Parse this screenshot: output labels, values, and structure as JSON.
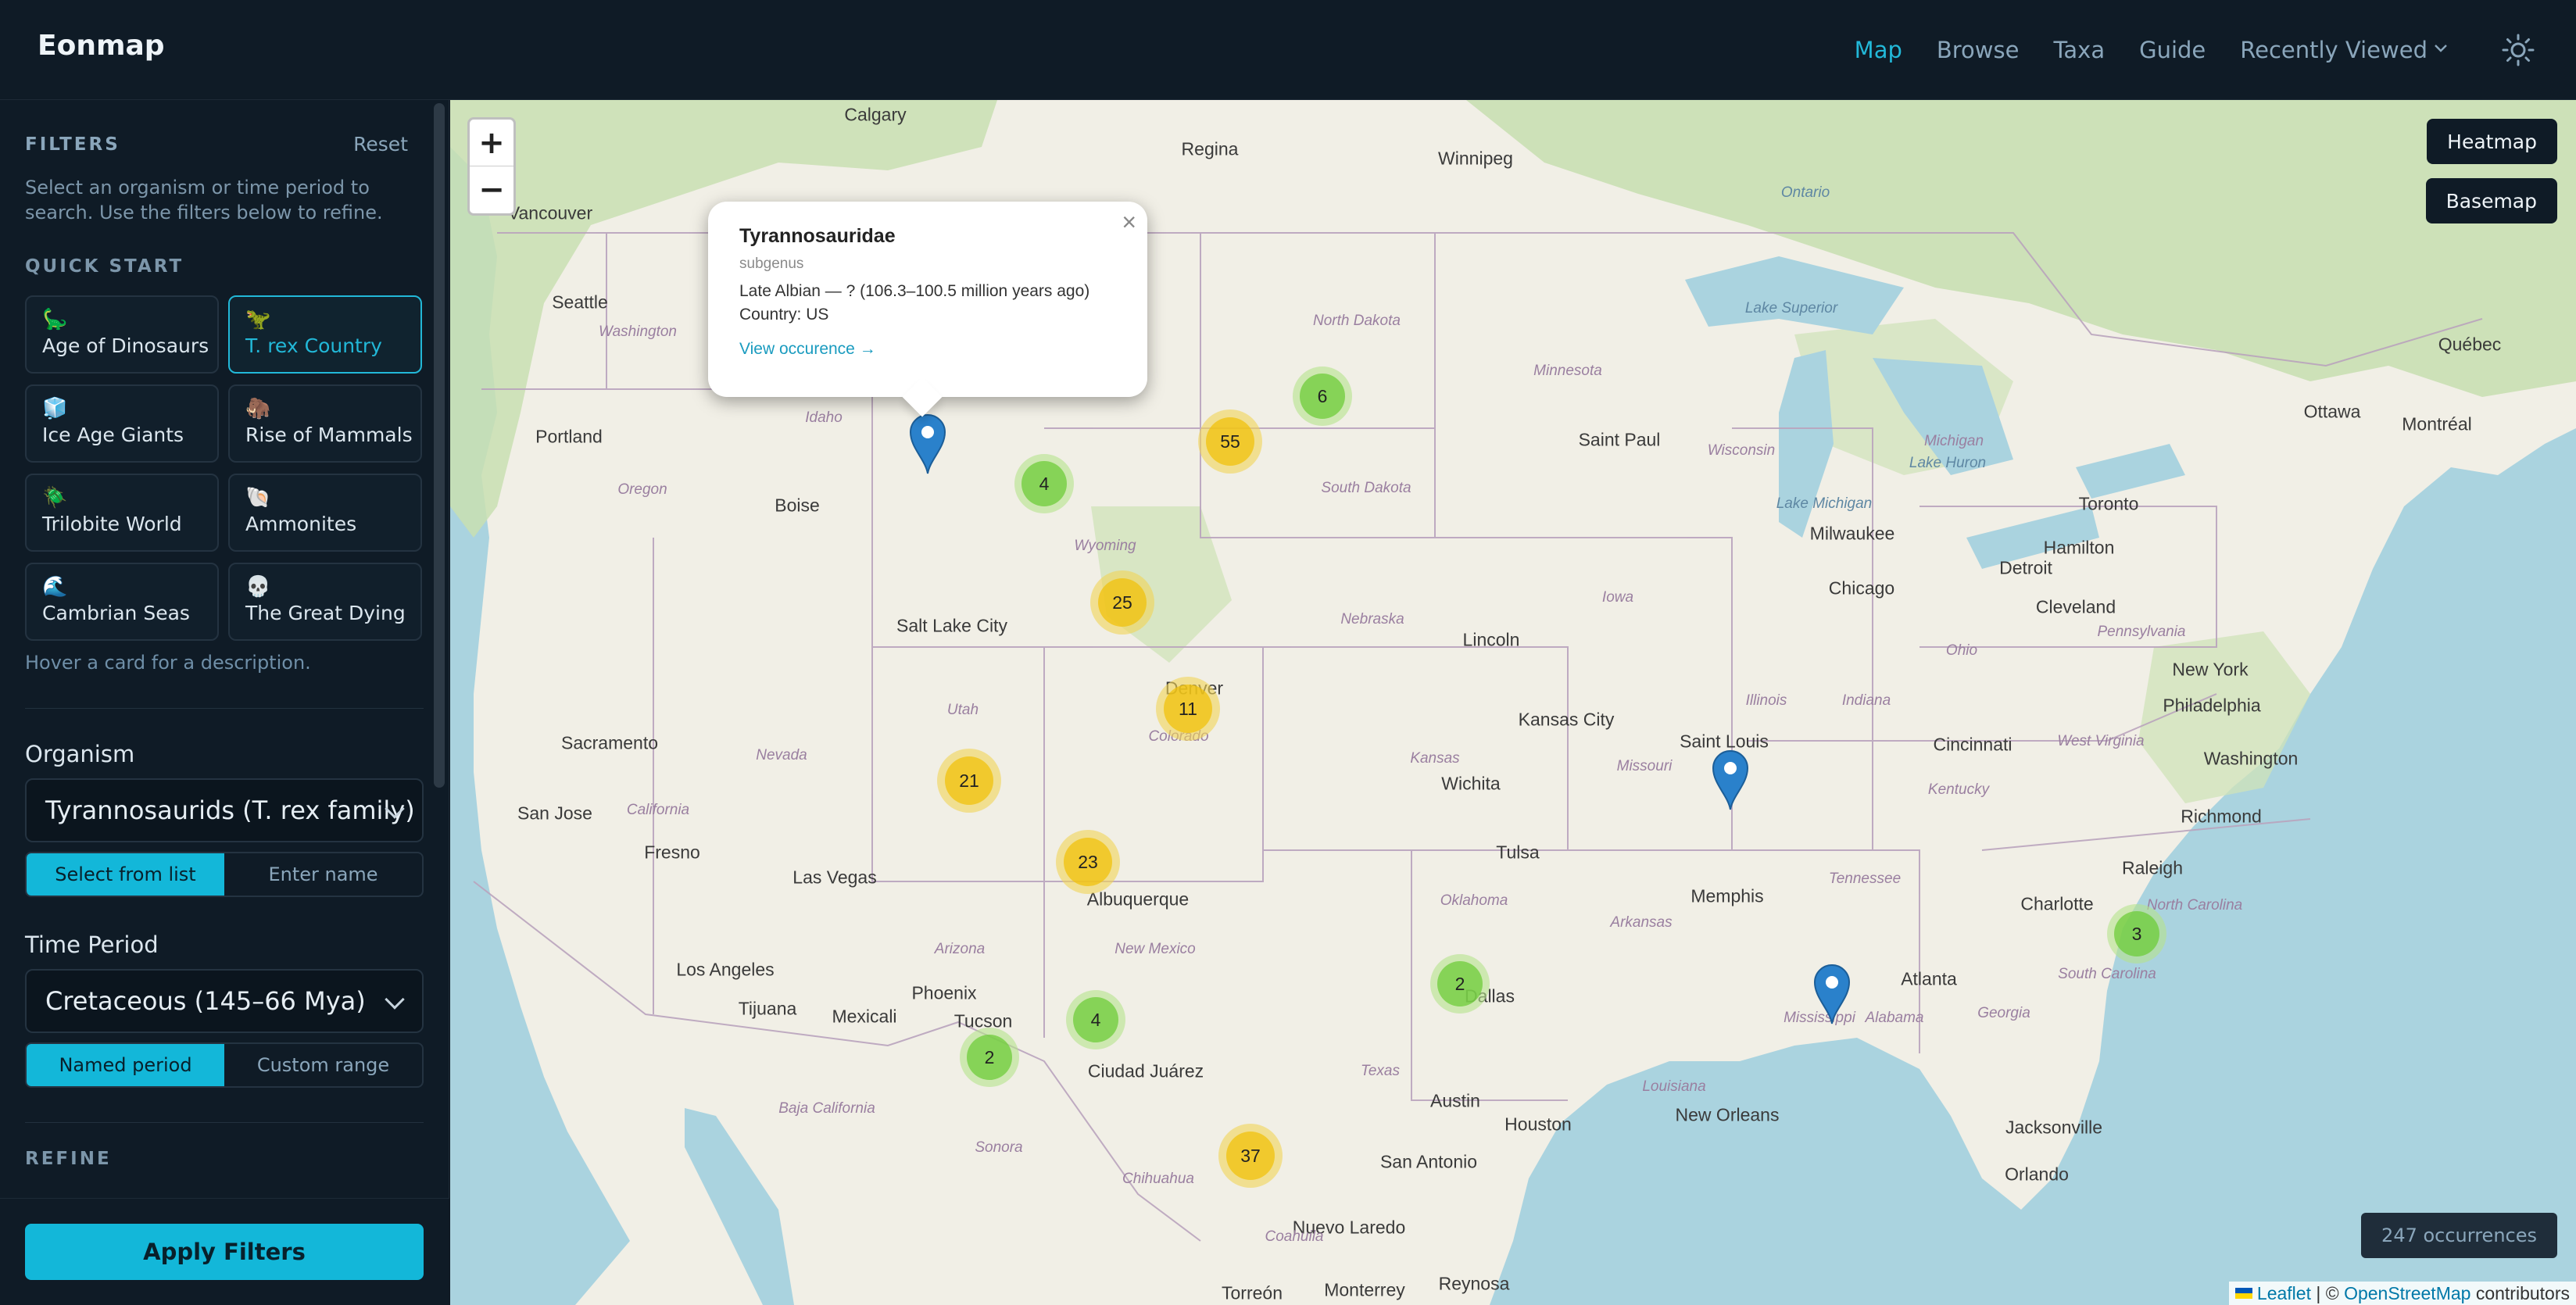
{
  "header": {
    "logo": "Eonmap",
    "nav": [
      {
        "label": "Map",
        "active": true
      },
      {
        "label": "Browse",
        "active": false
      },
      {
        "label": "Taxa",
        "active": false
      },
      {
        "label": "Guide",
        "active": false
      }
    ],
    "recently_viewed": "Recently Viewed",
    "theme_icon": "sun-icon"
  },
  "sidebar": {
    "title": "FILTERS",
    "reset": "Reset",
    "description": "Select an organism or time period to search. Use the filters below to refine.",
    "quick_start_title": "QUICK START",
    "cards": [
      {
        "icon": "🦕",
        "label": "Age of Dinosaurs"
      },
      {
        "icon": "🦖",
        "label": "T. rex Country"
      },
      {
        "icon": "🧊",
        "label": "Ice Age Giants"
      },
      {
        "icon": "🦣",
        "label": "Rise of Mammals"
      },
      {
        "icon": "🪲",
        "label": "Trilobite World"
      },
      {
        "icon": "🐚",
        "label": "Ammonites"
      },
      {
        "icon": "🌊",
        "label": "Cambrian Seas"
      },
      {
        "icon": "💀",
        "label": "The Great Dying"
      }
    ],
    "selected_card": "T. rex Country",
    "hover_hint": "Hover a card for a description.",
    "organism": {
      "label": "Organism",
      "value": "Tyrannosaurids (T. rex family)",
      "modes": [
        "Select from list",
        "Enter name"
      ],
      "active_mode": "Select from list"
    },
    "time_period": {
      "label": "Time Period",
      "value": "Cretaceous (145–66 Mya)",
      "modes": [
        "Named period",
        "Custom range"
      ],
      "active_mode": "Named period"
    },
    "refine_title": "REFINE",
    "apply": "Apply Filters"
  },
  "map": {
    "zoom_in": "+",
    "zoom_out": "−",
    "heatmap": "Heatmap",
    "basemap": "Basemap",
    "occurrences": "247 occurrences",
    "attribution": {
      "leaflet": "Leaflet",
      "sep": " | © ",
      "osm": "OpenStreetMap",
      "suffix": " contributors"
    },
    "cities": [
      "Calgary",
      "Regina",
      "Winnipeg",
      "Vancouver",
      "Seattle",
      "Portland",
      "Boise",
      "Salt Lake City",
      "Sacramento",
      "San Jose",
      "Fresno",
      "Las Vegas",
      "Los Angeles",
      "Tijuana",
      "Mexicali",
      "Phoenix",
      "Tucson",
      "Albuquerque",
      "Ciudad Juárez",
      "Denver",
      "Lincoln",
      "Kansas City",
      "Wichita",
      "Tulsa",
      "Dallas",
      "Austin",
      "San Antonio",
      "Houston",
      "Nuevo Laredo",
      "Monterrey",
      "Reynosa",
      "Torreón",
      "Saint Paul",
      "Milwaukee",
      "Chicago",
      "Detroit",
      "Cleveland",
      "Toronto",
      "Hamilton",
      "Ottawa",
      "Montréal",
      "Québec",
      "New York",
      "Philadelphia",
      "Washington",
      "Richmond",
      "Raleigh",
      "Charlotte",
      "Atlanta",
      "Jacksonville",
      "Orlando",
      "Memphis",
      "New Orleans",
      "Saint Louis",
      "Cincinnati",
      "Ontario"
    ],
    "states": [
      "Washington",
      "Oregon",
      "Idaho",
      "California",
      "Nevada",
      "Utah",
      "Arizona",
      "Wyoming",
      "Colorado",
      "New Mexico",
      "North Dakota",
      "South Dakota",
      "Nebraska",
      "Kansas",
      "Oklahoma",
      "Texas",
      "Minnesota",
      "Iowa",
      "Missouri",
      "Arkansas",
      "Louisiana",
      "Mississippi",
      "Alabama",
      "Georgia",
      "Tennessee",
      "Kentucky",
      "Illinois",
      "Indiana",
      "Ohio",
      "Wisconsin",
      "Michigan",
      "Pennsylvania",
      "West Virginia",
      "North Carolina",
      "South Carolina",
      "Baja California",
      "Sonora",
      "Chihuahua",
      "Coahuila"
    ],
    "lakes": [
      "Lake Superior",
      "Lake Michigan",
      "Lake Huron"
    ],
    "clusters": [
      {
        "count": "6",
        "color": "green"
      },
      {
        "count": "55",
        "color": "yellow"
      },
      {
        "count": "4",
        "color": "green"
      },
      {
        "count": "25",
        "color": "yellow"
      },
      {
        "count": "11",
        "color": "yellow"
      },
      {
        "count": "21",
        "color": "yellow"
      },
      {
        "count": "23",
        "color": "yellow"
      },
      {
        "count": "4",
        "color": "green"
      },
      {
        "count": "2",
        "color": "green"
      },
      {
        "count": "37",
        "color": "yellow"
      },
      {
        "count": "2",
        "color": "green"
      },
      {
        "count": "3",
        "color": "green"
      }
    ],
    "popup": {
      "title": "Tyrannosauridae",
      "subtitle": "subgenus",
      "age": "Late Albian — ? (106.3–100.5 million years ago)",
      "country": "Country: US",
      "link": "View occurence →",
      "close": "×"
    }
  }
}
